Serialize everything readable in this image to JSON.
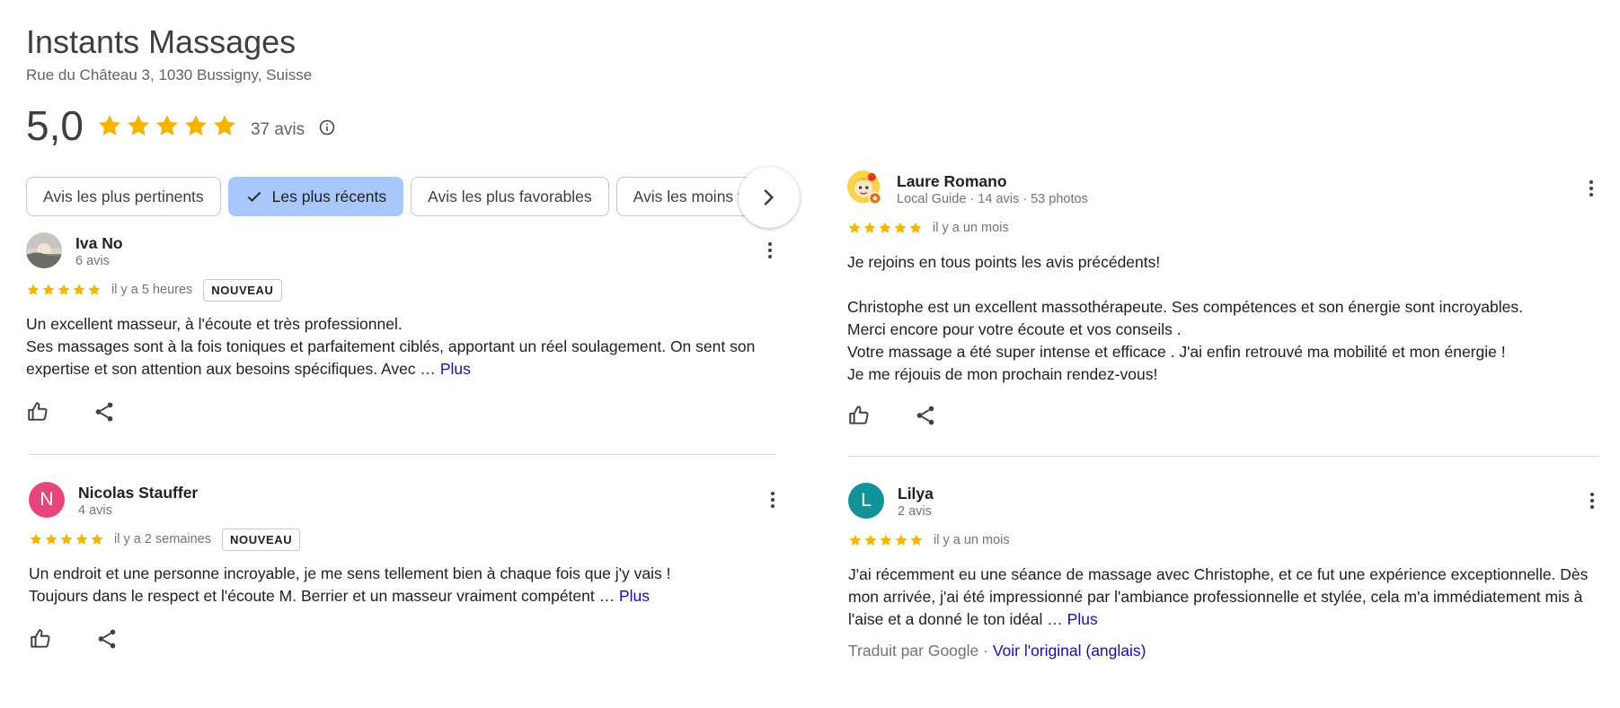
{
  "business": {
    "name": "Instants Massages",
    "address": "Rue du Château 3, 1030 Bussigny, Suisse",
    "rating": "5,0",
    "review_count": "37 avis",
    "star_color": "#f6b400"
  },
  "chips": [
    {
      "label": "Avis les plus pertinents",
      "selected": false
    },
    {
      "label": "Les plus récents",
      "selected": true
    },
    {
      "label": "Avis les plus favorables",
      "selected": false
    },
    {
      "label": "Avis les moins favorables",
      "selected": false
    }
  ],
  "reviews": [
    {
      "name": "Iva No",
      "meta": "6 avis",
      "avatar_icon": "sunset-photo-avatar",
      "stars": 5,
      "date": "il y a 5 heures",
      "badge": "NOUVEAU",
      "text": [
        "Un excellent masseur, à l'écoute et très professionnel.",
        "Ses massages sont à la fois toniques et parfaitement ciblés, apportant un réel soulagement. On sent son expertise et son attention aux besoins spécifiques. Avec …"
      ],
      "more": "Plus"
    },
    {
      "name": "Nicolas Stauffer",
      "meta": "4 avis",
      "avatar_letter": "N",
      "avatar_color": "#e8457c",
      "stars": 5,
      "date": "il y a 2 semaines",
      "badge": "NOUVEAU",
      "text": [
        "Un endroit et une personne incroyable, je me sens tellement bien à chaque fois que j'y vais !",
        "Toujours dans le respect et l'écoute M. Berrier et un masseur vraiment compétent …"
      ],
      "more": "Plus"
    },
    {
      "name": "Laure Romano",
      "meta": "Local Guide · 14 avis · 53 photos",
      "avatar_icon": "cartoon-avatar",
      "stars": 5,
      "date": "il y a un mois",
      "text": [
        "Je rejoins en tous points les avis précédents!",
        "",
        "Christophe est un excellent massothérapeute. Ses compétences et son énergie sont incroyables.",
        "Merci encore pour votre écoute et vos conseils .",
        "Votre massage a été super intense et efficace . J'ai enfin retrouvé ma mobilité et mon énergie !",
        "Je me réjouis de mon prochain rendez-vous!"
      ]
    },
    {
      "name": "Lilya",
      "meta": "2 avis",
      "avatar_letter": "L",
      "avatar_color": "#12939a",
      "stars": 5,
      "date": "il y a un mois",
      "text": [
        "J'ai récemment eu une séance de massage avec Christophe, et ce fut une expérience exceptionnelle. Dès mon arrivée, j'ai été impressionné par l'ambiance professionnelle et stylée, cela m'a immédiatement mis à l'aise et a donné le ton idéal …"
      ],
      "more": "Plus",
      "translated_by": "Traduit par Google ·",
      "view_original": "Voir l'original (anglais)"
    }
  ]
}
